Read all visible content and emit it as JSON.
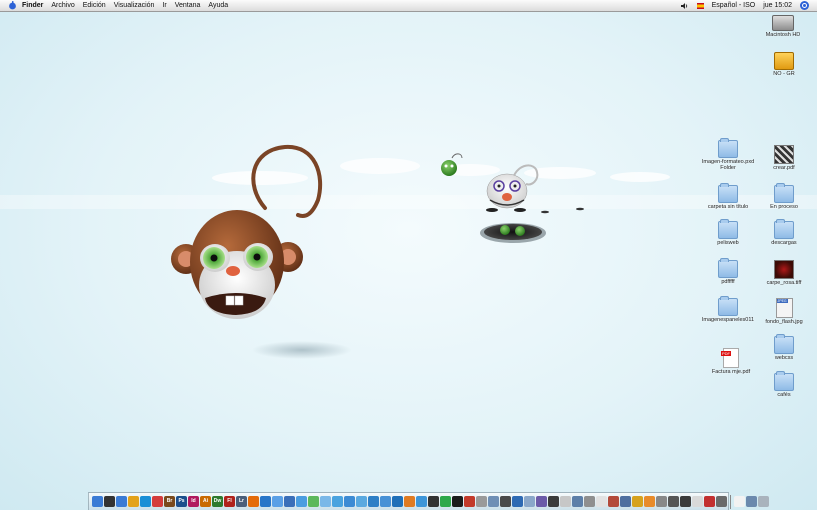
{
  "menubar": {
    "apple_icon": "apple-icon",
    "app_name": "Finder",
    "menus": [
      "Archivo",
      "Edición",
      "Visualización",
      "Ir",
      "Ventana",
      "Ayuda"
    ],
    "input_source": "Español - ISO",
    "clock": "jue 15:02"
  },
  "desktop_icons": {
    "hd": "Macintosh HD",
    "usb": "NO - GR",
    "f1": "Imagen-formateo.pxd Folder",
    "f2": "carpeta sin título",
    "f3": "pelisweb",
    "f4": "pdfffff",
    "f5": "Imagenespaneles011",
    "pdf": "Factura mje.pdf",
    "img1": "crear.pdf",
    "f6": "En proceso",
    "f7": "descargas",
    "img2": "carpe_rosa.tiff",
    "jpg": "fondo_flash.jpg",
    "f8": "webcss",
    "f9": "cafés"
  },
  "colors": {
    "desktop_bg": "#e3f3f8",
    "monkey_fur": "#8a4a26",
    "monkey_face": "#ececec",
    "monkey_eye": "#4fa83a"
  },
  "dock": {
    "apps": [
      {
        "icon": "finder-icon",
        "color": "#3a7bd5",
        "label": ""
      },
      {
        "icon": "dashboard-icon",
        "color": "#333333",
        "label": ""
      },
      {
        "icon": "finder-icon",
        "color": "#3a7bd5",
        "label": ""
      },
      {
        "icon": "preview-icon",
        "color": "#e3a21a",
        "label": ""
      },
      {
        "icon": "feather-icon",
        "color": "#1a8fd6",
        "label": ""
      },
      {
        "icon": "ical-icon",
        "color": "#d43c3c",
        "label": ""
      },
      {
        "icon": "bridge-icon",
        "color": "#7a4a1c",
        "label": "Br"
      },
      {
        "icon": "photoshop-icon",
        "color": "#1c4f8c",
        "label": "Ps"
      },
      {
        "icon": "indesign-icon",
        "color": "#b01a5e",
        "label": "Id"
      },
      {
        "icon": "illustrator-icon",
        "color": "#c96a00",
        "label": "Ai"
      },
      {
        "icon": "dreamweaver-icon",
        "color": "#2f7a2f",
        "label": "Dw"
      },
      {
        "icon": "flash-icon",
        "color": "#b0221b",
        "label": "Fl"
      },
      {
        "icon": "lightroom-icon",
        "color": "#4b5f7a",
        "label": "Lr"
      },
      {
        "icon": "firefox-icon",
        "color": "#e46c0a",
        "label": ""
      },
      {
        "icon": "globe-icon",
        "color": "#2876c8",
        "label": ""
      },
      {
        "icon": "ichat-icon",
        "color": "#5aa0e6",
        "label": ""
      },
      {
        "icon": "itunes-icon",
        "color": "#3a6fb9",
        "label": ""
      },
      {
        "icon": "safari-icon",
        "color": "#4a9de0",
        "label": ""
      },
      {
        "icon": "app-icon",
        "color": "#5cb85c",
        "label": ""
      },
      {
        "icon": "app-icon",
        "color": "#7ab8e8",
        "label": ""
      },
      {
        "icon": "app-icon",
        "color": "#4aa3df",
        "label": ""
      },
      {
        "icon": "app-icon",
        "color": "#3d8bd4",
        "label": ""
      },
      {
        "icon": "app-icon",
        "color": "#5aa9e0",
        "label": ""
      },
      {
        "icon": "app-icon",
        "color": "#2e7fc6",
        "label": ""
      },
      {
        "icon": "app-icon",
        "color": "#4891d6",
        "label": ""
      },
      {
        "icon": "app-icon",
        "color": "#1f6fb8",
        "label": ""
      },
      {
        "icon": "app-icon",
        "color": "#e07b22",
        "label": ""
      },
      {
        "icon": "app-icon",
        "color": "#3d95d8",
        "label": ""
      },
      {
        "icon": "app-icon",
        "color": "#333333",
        "label": ""
      },
      {
        "icon": "app-icon",
        "color": "#2da84a",
        "label": ""
      },
      {
        "icon": "app-icon",
        "color": "#1b1b1b",
        "label": ""
      },
      {
        "icon": "app-icon",
        "color": "#c33a2b",
        "label": ""
      },
      {
        "icon": "app-icon",
        "color": "#9a9a9a",
        "label": ""
      },
      {
        "icon": "app-icon",
        "color": "#6f8fb5",
        "label": ""
      },
      {
        "icon": "app-icon",
        "color": "#4a4a4a",
        "label": ""
      },
      {
        "icon": "app-icon",
        "color": "#2e6ab3",
        "label": ""
      },
      {
        "icon": "app-icon",
        "color": "#8aa7c9",
        "label": ""
      },
      {
        "icon": "app-icon",
        "color": "#6c5ba8",
        "label": ""
      },
      {
        "icon": "app-icon",
        "color": "#3b3b3b",
        "label": ""
      },
      {
        "icon": "app-icon",
        "color": "#c7c7c7",
        "label": ""
      },
      {
        "icon": "app-icon",
        "color": "#5d7fa8",
        "label": ""
      },
      {
        "icon": "app-icon",
        "color": "#8f8f8f",
        "label": ""
      },
      {
        "icon": "app-icon",
        "color": "#e2e2e2",
        "label": ""
      },
      {
        "icon": "app-icon",
        "color": "#b34a3a",
        "label": ""
      },
      {
        "icon": "app-icon",
        "color": "#4f6f9f",
        "label": ""
      },
      {
        "icon": "app-icon",
        "color": "#d6a21e",
        "label": ""
      },
      {
        "icon": "app-icon",
        "color": "#e88b2a",
        "label": ""
      },
      {
        "icon": "app-icon",
        "color": "#888888",
        "label": ""
      },
      {
        "icon": "app-icon",
        "color": "#555555",
        "label": ""
      },
      {
        "icon": "app-icon",
        "color": "#3a3a3a",
        "label": ""
      },
      {
        "icon": "app-icon",
        "color": "#d9d9d9",
        "label": ""
      },
      {
        "icon": "app-icon",
        "color": "#c23030",
        "label": ""
      },
      {
        "icon": "app-icon",
        "color": "#6a6a6a",
        "label": ""
      }
    ],
    "trailing": [
      {
        "icon": "document-icon",
        "color": "#f2f2f2",
        "label": ""
      },
      {
        "icon": "stack-icon",
        "color": "#6b89ad",
        "label": ""
      },
      {
        "icon": "trash-icon",
        "color": "#a9b3bd",
        "label": ""
      }
    ]
  }
}
